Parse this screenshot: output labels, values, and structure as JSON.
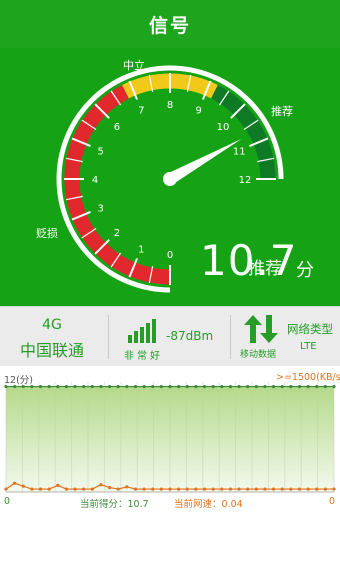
{
  "header": {
    "title": "信号"
  },
  "gauge": {
    "zone_labels": {
      "neutral": "中立",
      "recommend": "推荐",
      "negative": "贬损"
    },
    "ticks": [
      "0",
      "1",
      "2",
      "3",
      "4",
      "5",
      "6",
      "7",
      "8",
      "9",
      "10",
      "11",
      "12"
    ],
    "score": "10.7",
    "score_value": 10.7,
    "unit": "分",
    "level": "推荐",
    "colors": {
      "red": "#e0282d",
      "yellow": "#f0c91a",
      "green": "#0f7a26",
      "needle": "#ffffff"
    }
  },
  "stats": {
    "network_type": "4G",
    "carrier": "中国联通",
    "signal_dbm": "-87dBm",
    "signal_quality": "非常好",
    "mobile_data_label": "移动数据",
    "net_type_label": "网络类型",
    "net_type_value": "LTE"
  },
  "chart": {
    "left_top_label": "12(分)",
    "right_top_label": ">=1500(KB/s)",
    "left_bottom_label": "0",
    "right_bottom_label": "0",
    "current_score_text": "当前得分：10.7",
    "current_speed_text": "当前网速：0.04",
    "colors": {
      "score_line": "#3c8a3c",
      "speed_line": "#e07320",
      "fill": "#b4d98a"
    }
  },
  "chart_data": {
    "type": "area",
    "series": [
      {
        "values": [
          11.5,
          11.5,
          11.5,
          11.5,
          11.5,
          11.5,
          11.5,
          11.5,
          11.5,
          11.5,
          11.5,
          11.5,
          11.5,
          11.5,
          11.5,
          11.5,
          11.5,
          11.5,
          11.5,
          11.5,
          11.5,
          11.5,
          11.5,
          11.5,
          11.5,
          11.5,
          11.5,
          11.5,
          11.5,
          11.5,
          11.5,
          11.5,
          11.5,
          11.5,
          11.5,
          11.5,
          11.5,
          11.5,
          11.5
        ]
      },
      {
        "values": [
          40,
          120,
          80,
          40,
          40,
          40,
          90,
          40,
          40,
          40,
          40,
          100,
          60,
          40,
          70,
          40,
          40,
          40,
          40,
          40,
          40,
          40,
          40,
          40,
          40,
          40,
          40,
          40,
          40,
          40,
          40,
          40,
          40,
          40,
          40,
          40,
          40,
          40,
          40
        ]
      }
    ],
    "ylim_left": [
      0,
      12
    ],
    "ylim_right": [
      0,
      1500
    ]
  }
}
